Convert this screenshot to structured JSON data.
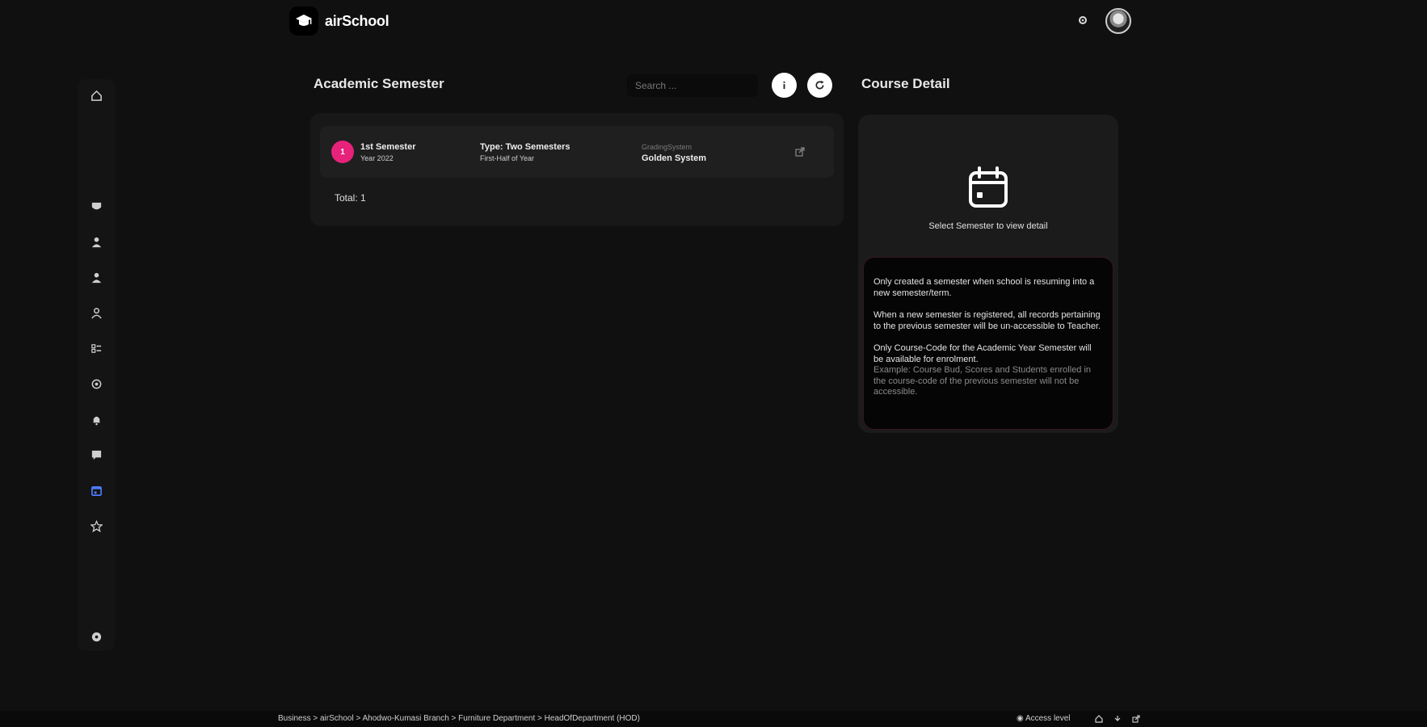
{
  "app": {
    "name": "airSchool",
    "logo_icon": "graduation-cap-icon"
  },
  "header": {
    "settings_icon": "gear-icon",
    "avatar_icon": "user-avatar"
  },
  "sidebar": {
    "items": [
      {
        "icon": "home-icon"
      },
      {
        "icon": "shield-icon"
      },
      {
        "icon": "user-icon"
      },
      {
        "icon": "user-icon"
      },
      {
        "icon": "user-icon"
      },
      {
        "icon": "checklist-icon"
      },
      {
        "icon": "badge-icon"
      },
      {
        "icon": "bell-icon"
      },
      {
        "icon": "message-icon"
      },
      {
        "icon": "calendar-icon",
        "active": true
      },
      {
        "icon": "star-icon"
      },
      {
        "icon": "settings-icon"
      }
    ],
    "active_color": "#4d7cff"
  },
  "semester": {
    "title": "Academic Semester",
    "search_placeholder": "Search ...",
    "rows": [
      {
        "number": "1",
        "name": "1st Semester",
        "year": "Year 2022",
        "type": "Type: Two Semesters",
        "period": "First-Half of Year",
        "grading_label": "GradingSystem",
        "grading_value": "Golden System"
      }
    ],
    "total": "Total: 1",
    "accent": "#e6227a"
  },
  "detail": {
    "title": "Course Detail",
    "hint": "Select Semester to view detail",
    "notes": [
      "Only created a semester when school is resuming into a new semester/term.",
      "When a new semester is registered, all records pertaining to the previous semester will be un-accessible to Teacher.",
      "Only Course-Code for the Academic Year Semester will be available for enrolment."
    ],
    "notes_faded": "Example: Course Bud, Scores and Students enrolled in the course-code of the previous semester will not be accessible."
  },
  "footer": {
    "breadcrumb": "Business > airSchool > Ahodwo-Kumasi Branch > Furniture Department > HeadOfDepartment (HOD)",
    "access_level": "Access level"
  }
}
